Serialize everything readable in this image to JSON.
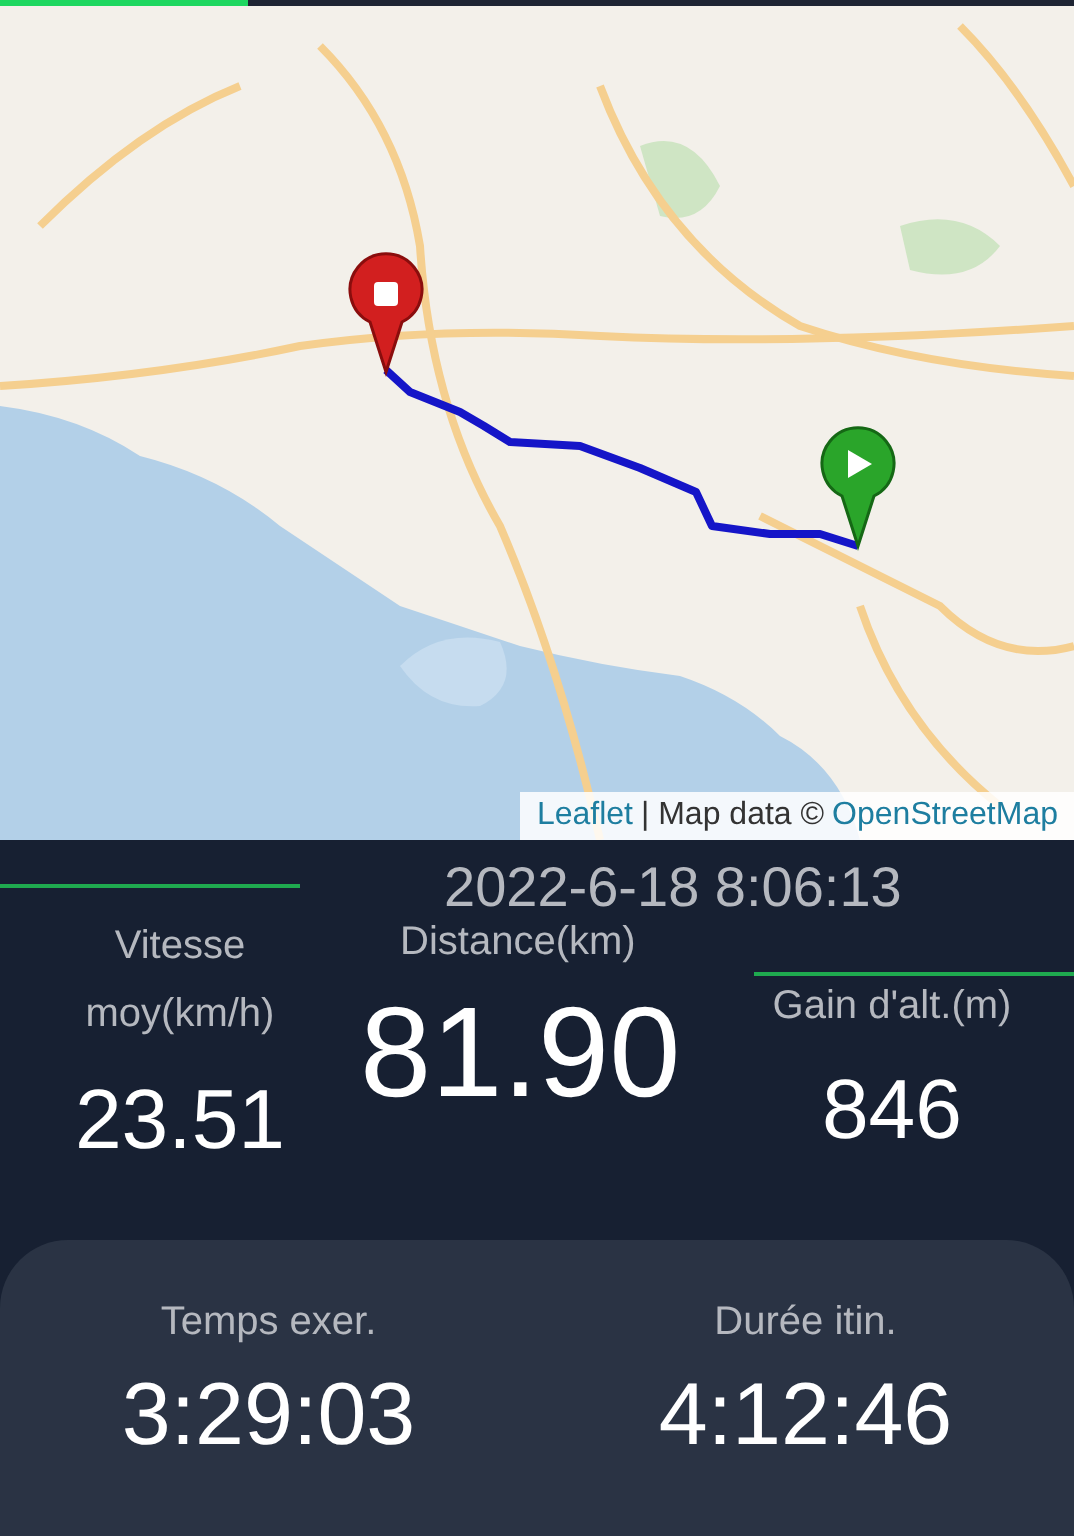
{
  "progress": {
    "level": 0.23
  },
  "map": {
    "kind": "picture",
    "attribution": [
      {
        "kind": "link",
        "text": "Leaflet"
      },
      {
        "kind": "text",
        "text": "| Map data ©"
      },
      {
        "kind": "link",
        "text": "OpenStreetMap"
      }
    ]
  },
  "timestamp": "2022-6-18 8:06:13",
  "stats": {
    "speed": {
      "label": "Vitesse moy(km/h)",
      "value": "23.51"
    },
    "distance": {
      "label": "Distance(km)",
      "value": "81.90"
    },
    "elevation": {
      "label": "Gain d'alt.(m)",
      "value": "846"
    }
  },
  "summary": [
    {
      "label": "Temps exer.",
      "value": "3:29:03"
    },
    {
      "label": "Durée itin.",
      "value": "4:12:46"
    }
  ]
}
